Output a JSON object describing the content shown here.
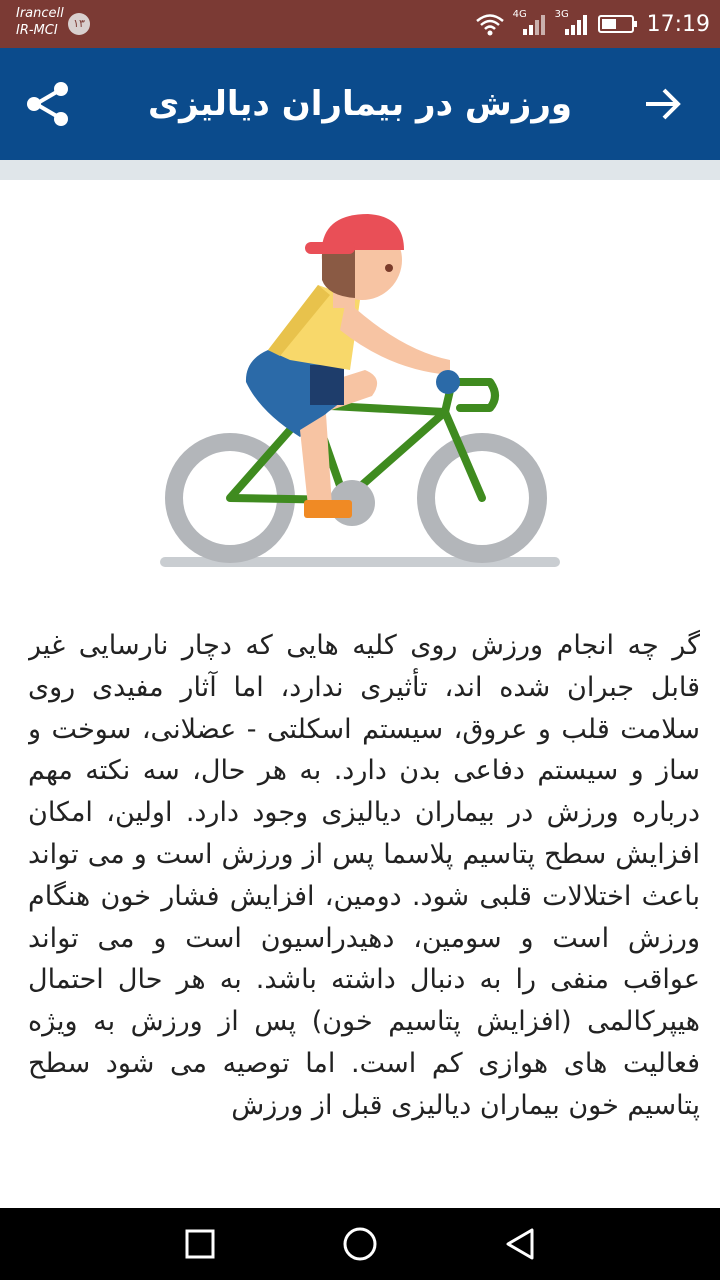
{
  "status_bar": {
    "carrier_line1": "Irancell",
    "carrier_line2": "IR-MCI",
    "badge": "۱۳",
    "network_4g": "4G",
    "network_3g": "3G",
    "time": "17:19"
  },
  "app_bar": {
    "title": "ورزش در بیماران دیالیزی",
    "background_color": "#0b4b8c",
    "share_icon": "share-icon",
    "back_icon": "arrow-forward-icon"
  },
  "illustration": {
    "icon": "cyclist-illustration"
  },
  "article": {
    "body": "گر چه انجام ورزش روی کلیه هایی که دچار نارسایی غیر قابل جبران شده اند، تأثیری ندارد، اما آثار مفیدی روی سلامت قلب و عروق، سیستم اسکلتی - عضلانی، سوخت و ساز و سیستم دفاعی بدن دارد. به هر حال، سه نکته مهم درباره ورزش در بیماران دیالیزی وجود دارد. اولین، امکان افزایش سطح پتاسیم پلاسما پس از ورزش است و می تواند باعث اختلالات قلبی شود. دومین، افزایش فشار خون هنگام ورزش است و سومین، دهیدراسیون است و می تواند عواقب منفی را به دنبال داشته باشد. به هر حال احتمال هیپرکالمی (افزایش پتاسیم خون) پس از ورزش به ویژه فعالیت های هوازی کم است. اما توصیه می شود سطح پتاسیم خون بیماران دیالیزی قبل از ورزش"
  },
  "nav_bar": {
    "recents_icon": "square-recents-icon",
    "home_icon": "circle-home-icon",
    "back_icon": "triangle-back-icon"
  }
}
